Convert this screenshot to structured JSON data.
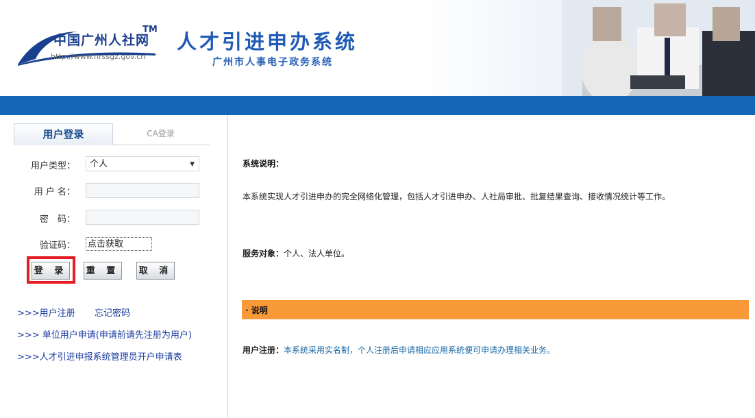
{
  "header": {
    "logo_text": "中国广州人社网",
    "logo_tm": "TM",
    "logo_url": "http://www.hrssgz.gov.cn",
    "system_title": "人才引进申办系统",
    "system_subtitle": "广州市人事电子政务系统"
  },
  "login": {
    "tab_user": "用户登录",
    "tab_ca": "CA登录",
    "user_type_label": "用户类型：",
    "user_type_value": "个人",
    "username_label": "用 户 名：",
    "password_label": "密　码：",
    "captcha_label": "验证码：",
    "captcha_value": "点击获取",
    "login_button": "登 录",
    "reset_button": "重 置",
    "cancel_button": "取 消"
  },
  "links": {
    "register": ">>>用户注册",
    "forgot": "忘记密码",
    "unit_apply": ">>>  单位用户申请(申请前请先注册为用户)",
    "admin_apply": ">>>人才引进申报系统管理员开户申请表"
  },
  "content": {
    "system_desc_title": "系统说明：",
    "system_desc_text": "本系统实现人才引进申办的完全网络化管理，包括人才引进申办、人社局审批、批复结果查询、接收情况统计等工作。",
    "service_label": "服务对象：",
    "service_text": "个人、法人单位。",
    "notice_bar": "· 说明",
    "register_label": "用户注册：",
    "register_text": "本系统采用实名制，个人注册后申请相应应用系统便可申请办理相关业务。"
  },
  "colors": {
    "accent_blue": "#1466b8",
    "orange_bar": "#f99a38",
    "highlight_red": "#e51c23"
  }
}
